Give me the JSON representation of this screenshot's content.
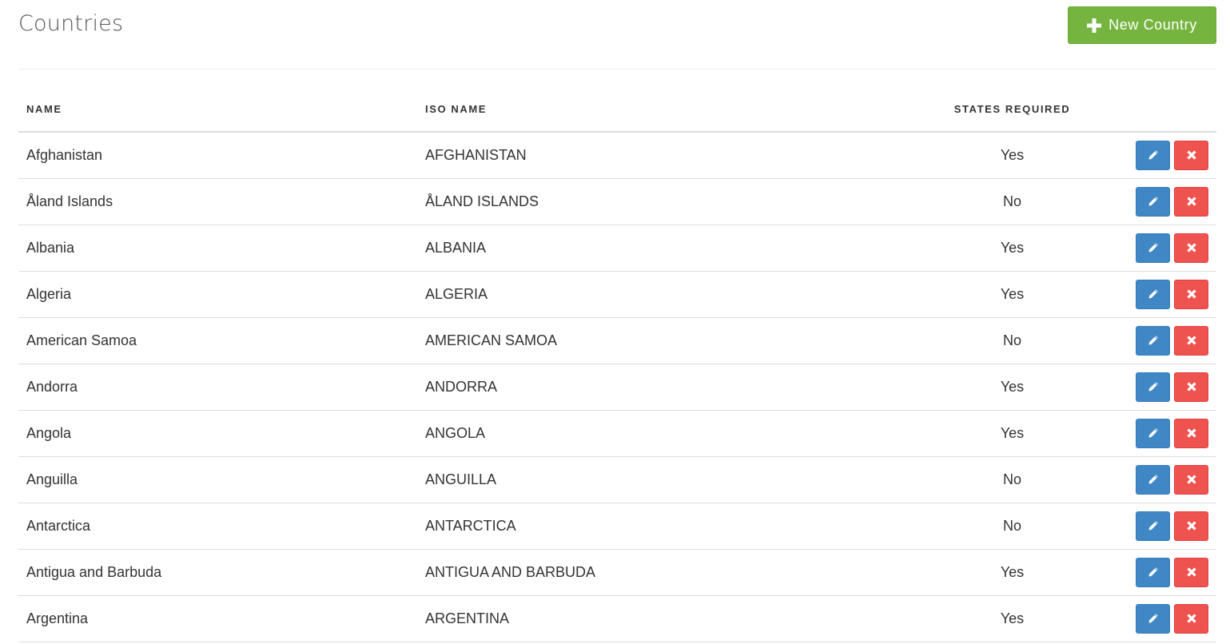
{
  "header": {
    "title": "Countries",
    "new_button_label": "New Country"
  },
  "table": {
    "columns": [
      "NAME",
      "ISO NAME",
      "STATES REQUIRED",
      ""
    ],
    "rows": [
      {
        "name": "Afghanistan",
        "iso_name": "AFGHANISTAN",
        "states_required": "Yes"
      },
      {
        "name": "Åland Islands",
        "iso_name": "ÅLAND ISLANDS",
        "states_required": "No"
      },
      {
        "name": "Albania",
        "iso_name": "ALBANIA",
        "states_required": "Yes"
      },
      {
        "name": "Algeria",
        "iso_name": "ALGERIA",
        "states_required": "Yes"
      },
      {
        "name": "American Samoa",
        "iso_name": "AMERICAN SAMOA",
        "states_required": "No"
      },
      {
        "name": "Andorra",
        "iso_name": "ANDORRA",
        "states_required": "Yes"
      },
      {
        "name": "Angola",
        "iso_name": "ANGOLA",
        "states_required": "Yes"
      },
      {
        "name": "Anguilla",
        "iso_name": "ANGUILLA",
        "states_required": "No"
      },
      {
        "name": "Antarctica",
        "iso_name": "ANTARCTICA",
        "states_required": "No"
      },
      {
        "name": "Antigua and Barbuda",
        "iso_name": "ANTIGUA AND BARBUDA",
        "states_required": "Yes"
      },
      {
        "name": "Argentina",
        "iso_name": "ARGENTINA",
        "states_required": "Yes"
      }
    ],
    "row_actions": {
      "edit_icon": "pencil-icon",
      "delete_icon": "close-icon"
    }
  },
  "colors": {
    "new_button": "#75b53f",
    "edit_button": "#3f88c5",
    "delete_button": "#ef5350"
  }
}
